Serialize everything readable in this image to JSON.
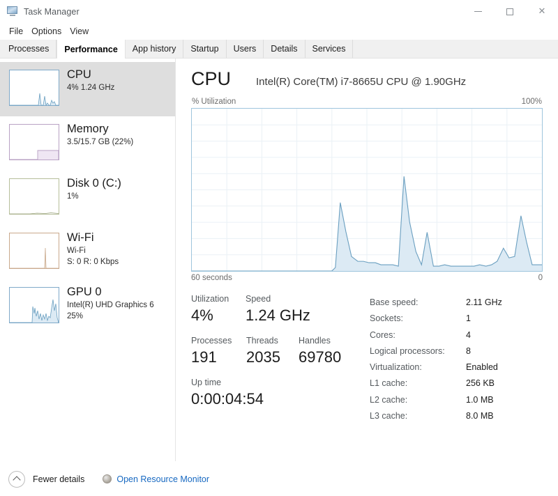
{
  "window": {
    "title": "Task Manager",
    "icon": "task-manager-icon",
    "controls": {
      "minimize": "—",
      "maximize": "□",
      "close": "✕"
    }
  },
  "menubar": {
    "items": [
      "File",
      "Options",
      "View"
    ]
  },
  "tabs": {
    "items": [
      "Processes",
      "Performance",
      "App history",
      "Startup",
      "Users",
      "Details",
      "Services"
    ],
    "active": "Performance"
  },
  "sidebar": {
    "items": [
      {
        "name": "CPU",
        "title": "CPU",
        "sub1": "4%  1.24 GHz",
        "sub2": "",
        "selected": true,
        "accent": "#7fa9c9"
      },
      {
        "name": "Memory",
        "title": "Memory",
        "sub1": "3.5/15.7 GB (22%)",
        "sub2": "",
        "selected": false,
        "accent": "#b9a2c4"
      },
      {
        "name": "Disk 0",
        "title": "Disk 0 (C:)",
        "sub1": "1%",
        "sub2": "",
        "selected": false,
        "accent": "#b6be9a"
      },
      {
        "name": "Wi-Fi",
        "title": "Wi-Fi",
        "sub1": "Wi-Fi",
        "sub2": "S: 0 R: 0 Kbps",
        "selected": false,
        "accent": "#c9a98c"
      },
      {
        "name": "GPU 0",
        "title": "GPU 0",
        "sub1": "Intel(R) UHD Graphics 6",
        "sub2": "25%",
        "selected": false,
        "accent": "#7fa9c9"
      }
    ]
  },
  "main": {
    "title": "CPU",
    "model": "Intel(R) Core(TM) i7-8665U CPU @ 1.90GHz",
    "graph_top_left_label": "% Utilization",
    "graph_top_right_label": "100%",
    "graph_bottom_left_label": "60 seconds",
    "graph_bottom_right_label": "0",
    "graph_line_color": "#6a9fc0",
    "graph_fill_color": "#dceaf4"
  },
  "chart_data": {
    "type": "area",
    "title": "% Utilization",
    "xlabel": "seconds",
    "ylabel": "% Utilization",
    "xlim": [
      60,
      0
    ],
    "ylim": [
      0,
      100
    ],
    "x_tick_labels": [
      "60 seconds",
      "0"
    ],
    "y_tick_labels": [
      "100%"
    ],
    "grid": true,
    "grid_columns": 10,
    "grid_rows": 10,
    "series": [
      {
        "name": "CPU utilization",
        "x": [
          60,
          42,
          36,
          35.4,
          34.6,
          33.4,
          32.4,
          31.2,
          30,
          28.6,
          27.2,
          25.6,
          24.4,
          23.4,
          22.2,
          21.2,
          20.2,
          19,
          18,
          17,
          16,
          15,
          14,
          13,
          12,
          11,
          10,
          9,
          8,
          7,
          6,
          5,
          4.2,
          3.2,
          2.2,
          1.4,
          0.6,
          0
        ],
        "values": [
          0,
          0,
          0,
          2,
          42,
          24,
          9,
          6,
          6,
          5,
          5,
          4,
          4,
          4,
          3,
          58,
          30,
          12,
          4,
          24,
          3,
          3,
          4,
          3,
          3,
          3,
          3,
          3,
          4,
          3,
          4,
          6,
          14,
          8,
          9,
          34,
          18,
          4
        ]
      }
    ]
  },
  "stats": {
    "utilization": {
      "label": "Utilization",
      "value": "4%"
    },
    "speed": {
      "label": "Speed",
      "value": "1.24 GHz"
    },
    "processes": {
      "label": "Processes",
      "value": "191"
    },
    "threads": {
      "label": "Threads",
      "value": "2035"
    },
    "handles": {
      "label": "Handles",
      "value": "69780"
    },
    "uptime": {
      "label": "Up time",
      "value": "0:00:04:54"
    }
  },
  "specs": [
    {
      "key": "Base speed:",
      "value": "2.11 GHz"
    },
    {
      "key": "Sockets:",
      "value": "1"
    },
    {
      "key": "Cores:",
      "value": "4"
    },
    {
      "key": "Logical processors:",
      "value": "8"
    },
    {
      "key": "Virtualization:",
      "value": "Enabled"
    },
    {
      "key": "L1 cache:",
      "value": "256 KB"
    },
    {
      "key": "L2 cache:",
      "value": "1.0 MB"
    },
    {
      "key": "L3 cache:",
      "value": "8.0 MB"
    }
  ],
  "footer": {
    "fewer_details": "Fewer details",
    "open_resource_monitor": "Open Resource Monitor",
    "link_color": "#1668c1"
  }
}
